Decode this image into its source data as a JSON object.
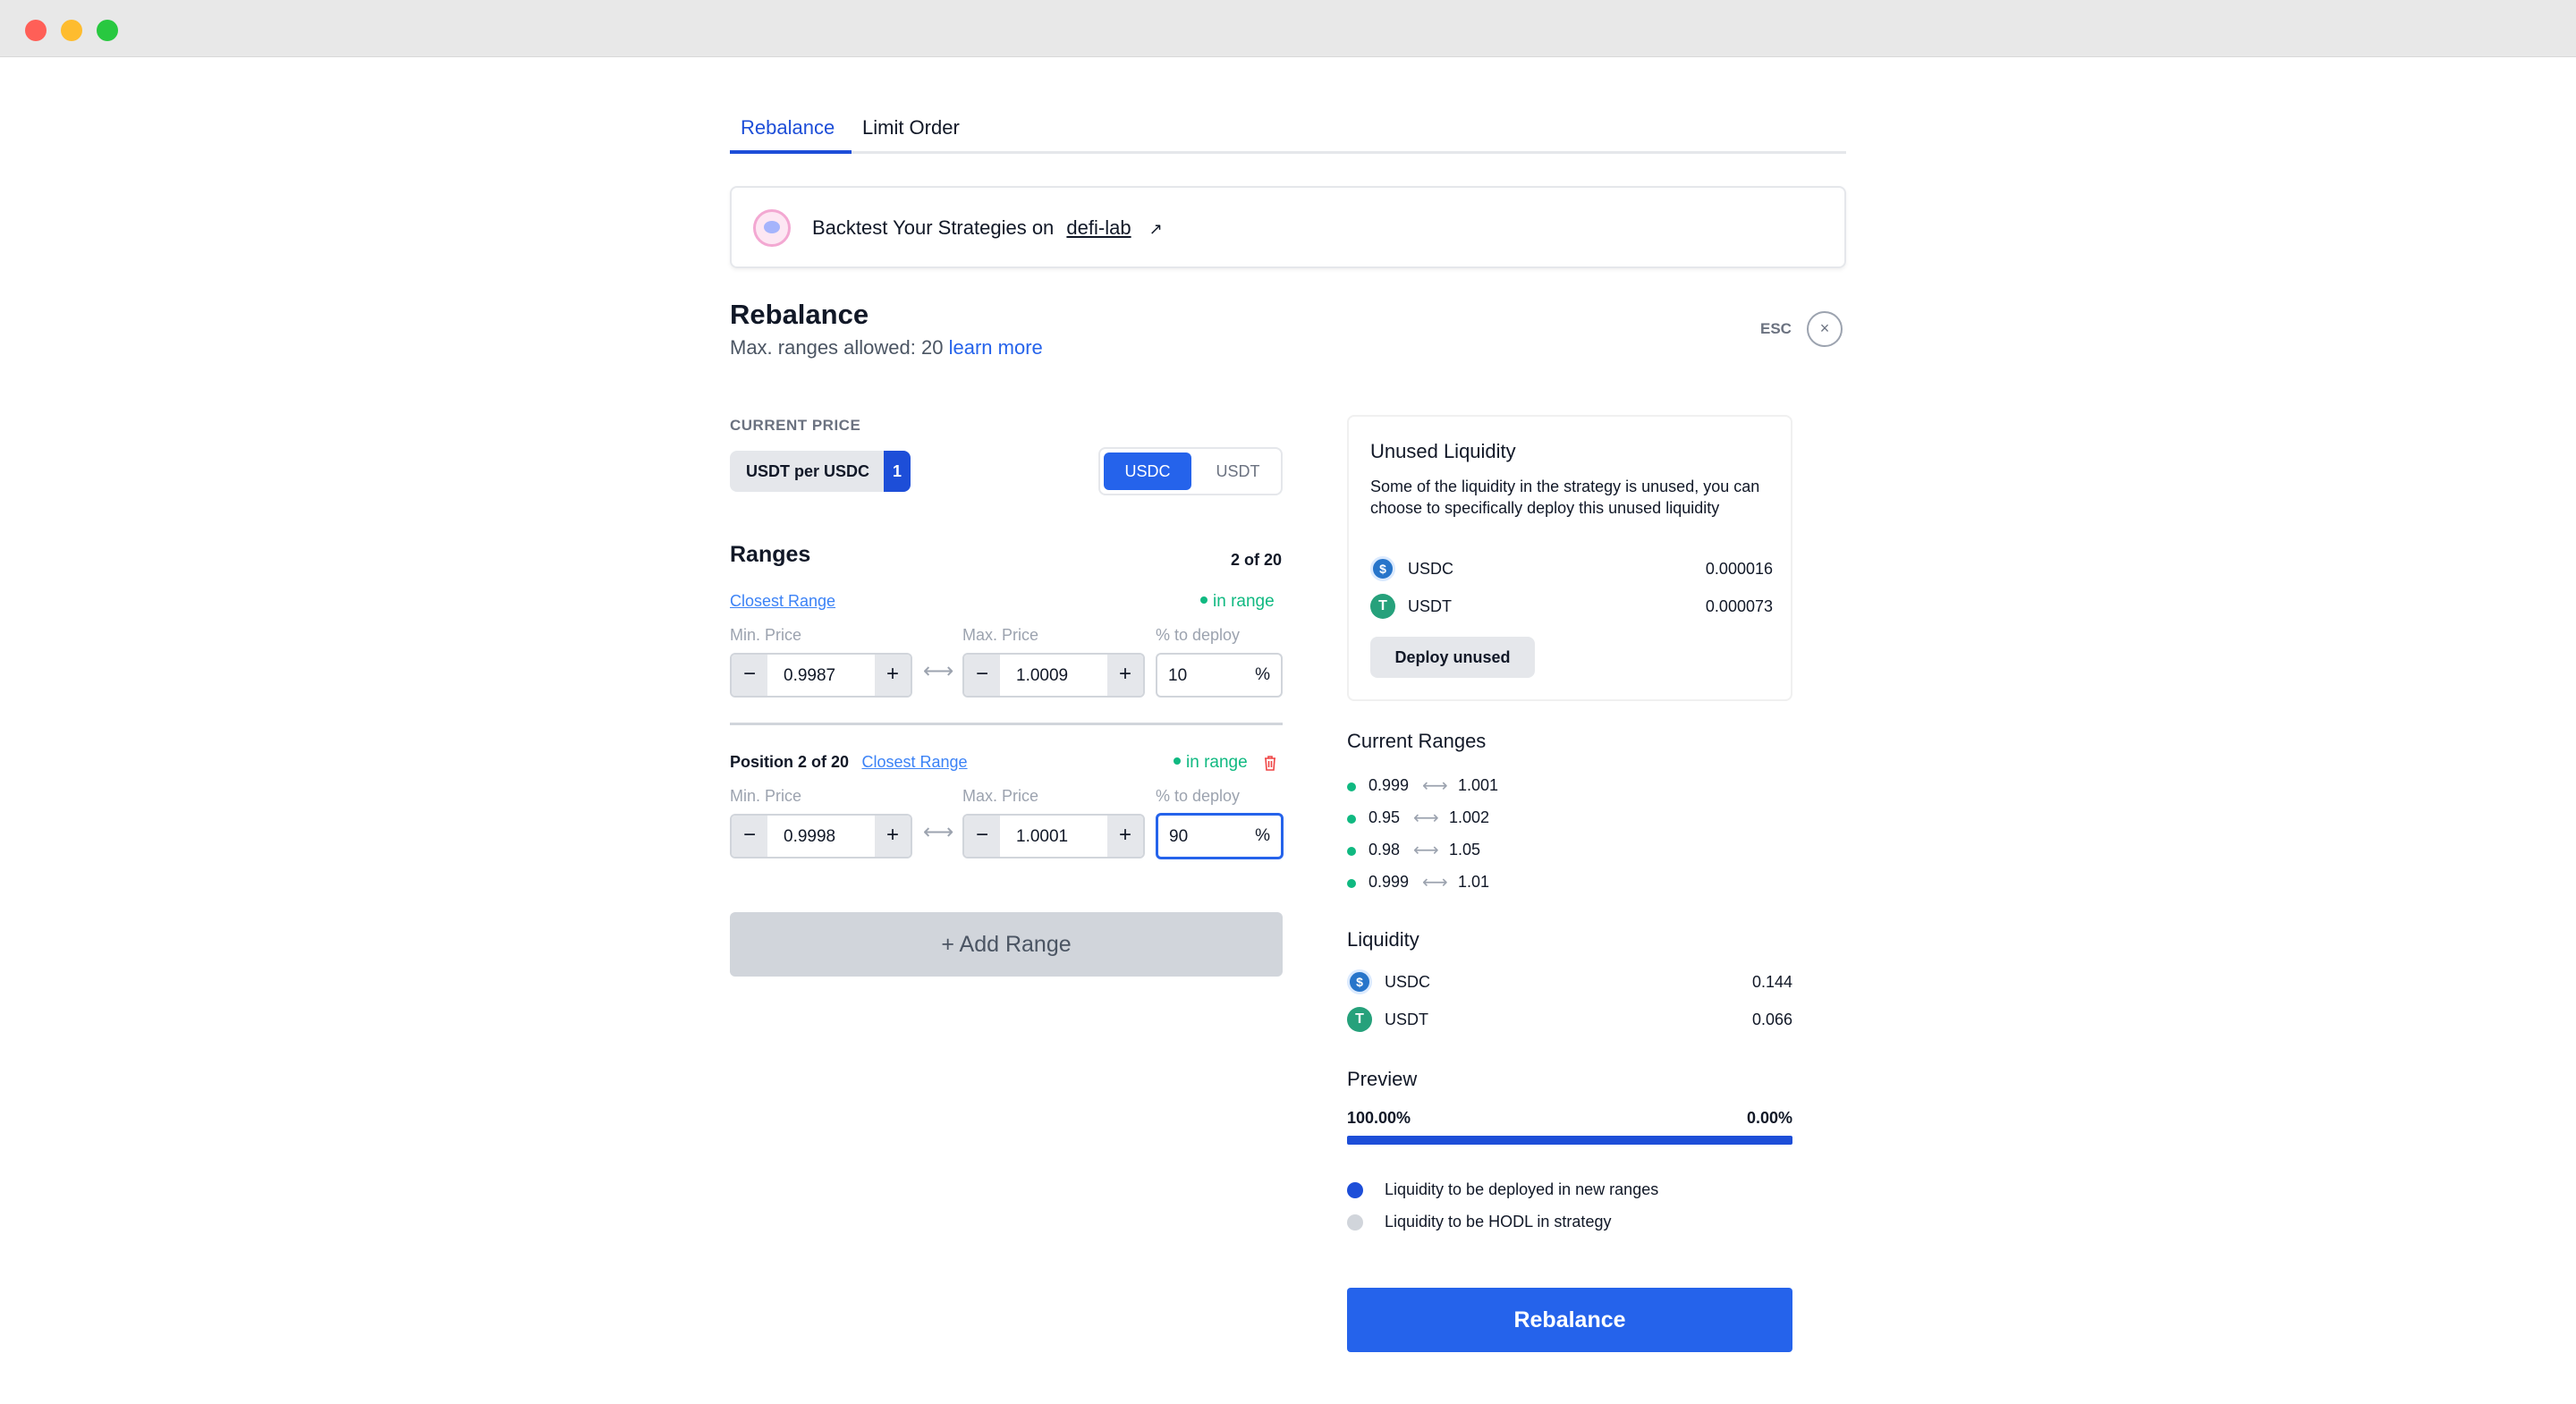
{
  "tabs": [
    {
      "label": "Rebalance",
      "active": true
    },
    {
      "label": "Limit Order",
      "active": false
    }
  ],
  "banner": {
    "text": "Backtest Your Strategies on",
    "link": "defi-lab",
    "arrow": "↗"
  },
  "header": {
    "title": "Rebalance",
    "subtitle": "Max. ranges allowed: 20",
    "learn_more": "learn more",
    "esc_label": "ESC",
    "close_icon": "×"
  },
  "current_price": {
    "label": "CURRENT PRICE",
    "pair": "USDT per USDC",
    "value": "1",
    "toggle": [
      "USDC",
      "USDT"
    ],
    "toggle_selected": "USDC"
  },
  "ranges": {
    "title": "Ranges",
    "count": "2 of 20",
    "items": [
      {
        "position_label": "",
        "closest_range": "Closest Range",
        "status": "in range",
        "min_label": "Min. Price",
        "min_value": "0.9987",
        "max_label": "Max. Price",
        "max_value": "1.0009",
        "pct_label": "% to deploy",
        "pct_value": "10",
        "pct_symbol": "%"
      },
      {
        "position_label": "Position 2 of 20",
        "closest_range": "Closest Range",
        "status": "in range",
        "min_label": "Min. Price",
        "min_value": "0.9998",
        "max_label": "Max. Price",
        "max_value": "1.0001",
        "pct_label": "% to deploy",
        "pct_value": "90",
        "pct_symbol": "%"
      }
    ],
    "add_range": "+ Add Range",
    "minus": "−",
    "plus": "+",
    "link_arrow": "⟷"
  },
  "unused_liquidity": {
    "title": "Unused Liquidity",
    "description": "Some of the liquidity in the strategy is unused, you can choose to specifically deploy this unused liquidity",
    "tokens": [
      {
        "name": "USDC",
        "value": "0.000016"
      },
      {
        "name": "USDT",
        "value": "0.000073"
      }
    ],
    "deploy_button": "Deploy unused"
  },
  "current_ranges": {
    "title": "Current Ranges",
    "items": [
      {
        "min": "0.999",
        "max": "1.001"
      },
      {
        "min": "0.95",
        "max": "1.002"
      },
      {
        "min": "0.98",
        "max": "1.05"
      },
      {
        "min": "0.999",
        "max": "1.01"
      }
    ],
    "arrow": "⟷"
  },
  "liquidity": {
    "title": "Liquidity",
    "tokens": [
      {
        "name": "USDC",
        "value": "0.144"
      },
      {
        "name": "USDT",
        "value": "0.066"
      }
    ]
  },
  "preview": {
    "title": "Preview",
    "left_pct": "100.00%",
    "right_pct": "0.00%",
    "deployed_fraction": 1.0,
    "legend": [
      {
        "label": "Liquidity to be deployed in new ranges",
        "color": "#1d4ed8"
      },
      {
        "label": "Liquidity to be HODL in strategy",
        "color": "#d1d5db"
      }
    ]
  },
  "action": {
    "rebalance_button": "Rebalance"
  },
  "colors": {
    "accent": "#2563eb",
    "in_range": "#10b981"
  }
}
